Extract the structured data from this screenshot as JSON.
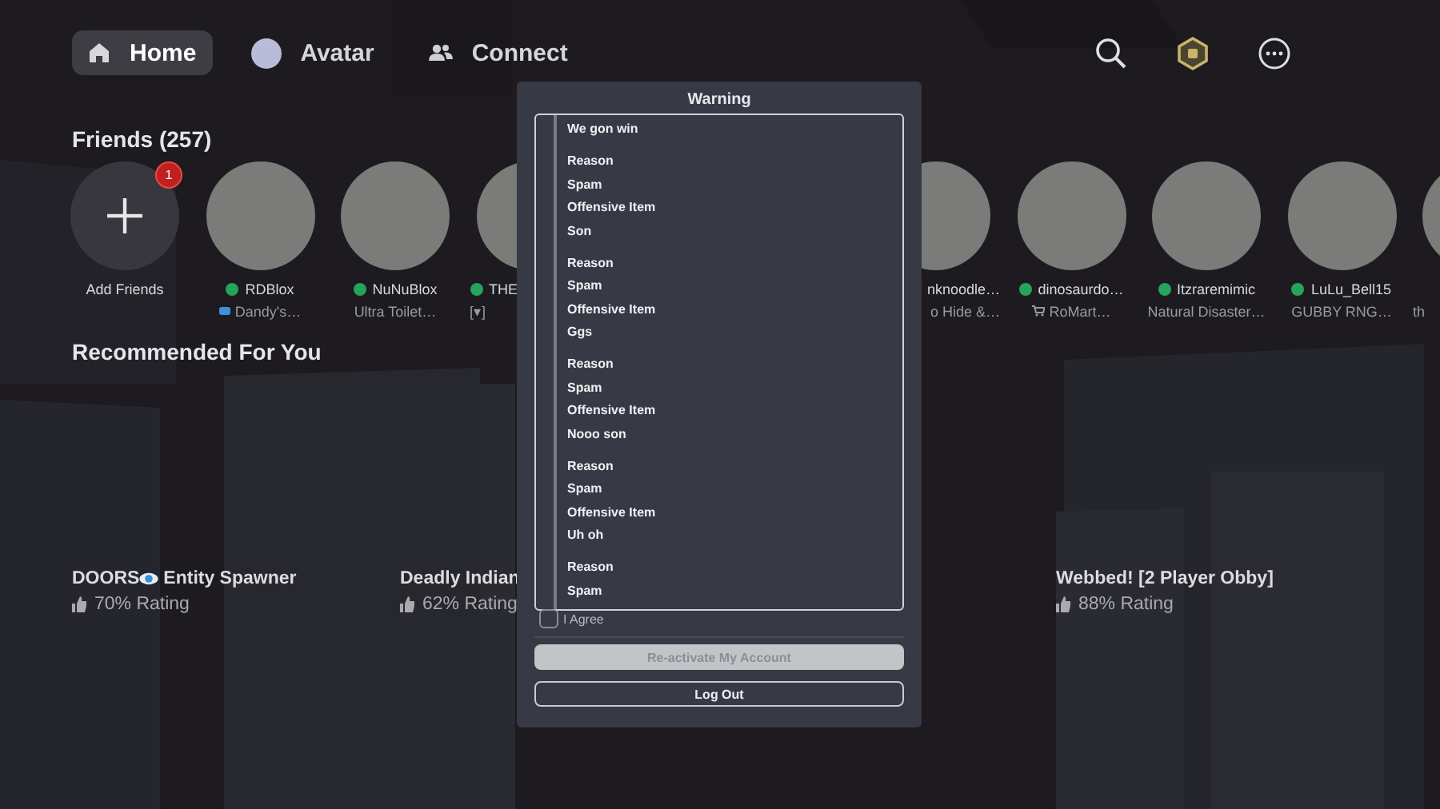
{
  "nav": {
    "tabs": [
      {
        "label": "Home",
        "selected": true
      },
      {
        "label": "Avatar",
        "selected": false
      },
      {
        "label": "Connect",
        "selected": false
      }
    ]
  },
  "friends": {
    "title": "Friends (257)",
    "add": {
      "label": "Add Friends",
      "badge": "1"
    },
    "items": [
      {
        "kind": "full",
        "name": "RDBlox",
        "online": true,
        "subtitle": "Dandy's…"
      },
      {
        "kind": "full",
        "name": "NuNuBlox",
        "online": true,
        "subtitle": "Ultra Toilet…"
      },
      {
        "kind": "cut_right",
        "name": "THE",
        "online": true,
        "subtitle": "[▾]"
      },
      {
        "kind": "gap"
      },
      {
        "kind": "gap"
      },
      {
        "kind": "cut_left",
        "name": "nknoodle…",
        "subtitle": "o Hide &…"
      },
      {
        "kind": "full",
        "name": "dinosaurdo…",
        "online": true,
        "subtitle": "RoMart…"
      },
      {
        "kind": "full",
        "name": "Itzraremimic",
        "online": true,
        "subtitle": "Natural Disaster…"
      },
      {
        "kind": "full",
        "name": "LuLu_Bell15",
        "online": true,
        "subtitle": "GUBBY RNG…"
      },
      {
        "kind": "edge",
        "subtitle": "th"
      }
    ]
  },
  "recommended": {
    "title": "Recommended For You",
    "games": [
      {
        "kind": "game",
        "title": "DOORS",
        "eye_icon": true,
        "title_rest": "Entity Spawner",
        "rating": "70% Rating"
      },
      {
        "kind": "game",
        "title": "Deadly Indian",
        "rating": "62% Rating"
      },
      {
        "kind": "gap"
      },
      {
        "kind": "game",
        "title": "Webbed! [2 Player Obby]",
        "rating": "88% Rating"
      }
    ]
  },
  "dialog": {
    "title": "Warning",
    "groups": [
      [
        "We gon win"
      ],
      [
        "Reason",
        "Spam",
        "Offensive Item",
        "Son"
      ],
      [
        "Reason",
        "Spam",
        "Offensive Item",
        "Ggs"
      ],
      [
        "Reason",
        "Spam",
        "Offensive Item",
        "Nooo son"
      ],
      [
        "Reason",
        "Spam",
        "Offensive Item",
        "Uh oh"
      ],
      [
        "Reason",
        "Spam"
      ]
    ],
    "agree": {
      "label": "I Agree",
      "checked": false
    },
    "buttons": [
      {
        "label": "Re-activate My Account",
        "kind": "filled",
        "disabled": true
      },
      {
        "label": "Log Out",
        "kind": "outline",
        "disabled": false
      }
    ]
  }
}
